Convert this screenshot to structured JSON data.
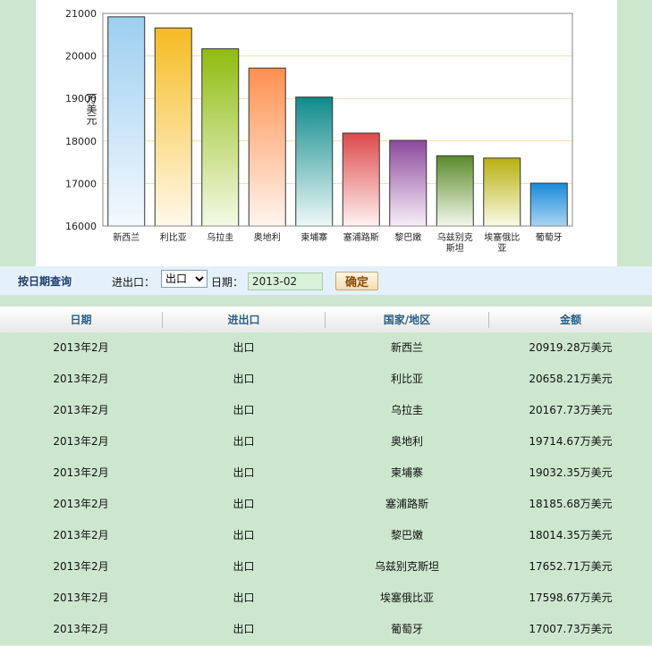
{
  "chart_data": {
    "type": "bar",
    "categories": [
      "新西兰",
      "利比亚",
      "乌拉圭",
      "奥地利",
      "柬埔寨",
      "塞浦路斯",
      "黎巴嫩",
      "乌兹别克斯坦",
      "埃塞俄比亚",
      "葡萄牙"
    ],
    "category_display": [
      [
        "新西兰"
      ],
      [
        "利比亚"
      ],
      [
        "乌拉圭"
      ],
      [
        "奥地利"
      ],
      [
        "柬埔寨"
      ],
      [
        "塞浦路斯"
      ],
      [
        "黎巴嫩"
      ],
      [
        "乌兹别克",
        "斯坦"
      ],
      [
        "埃塞俄比",
        "亚"
      ],
      [
        "葡萄牙"
      ]
    ],
    "values": [
      20919.28,
      20658.21,
      20167.73,
      19714.67,
      19032.35,
      18185.68,
      18014.35,
      17652.71,
      17598.67,
      17007.73
    ],
    "ylabel": "万美元",
    "ylim": [
      16000,
      21000
    ],
    "yticks": [
      16000,
      17000,
      18000,
      19000,
      20000,
      21000
    ],
    "grid": true,
    "colors": [
      [
        "#9ccff0",
        "#f4f9fe"
      ],
      [
        "#f5bb22",
        "#fff9ea"
      ],
      [
        "#8fbc10",
        "#f4fae6"
      ],
      [
        "#ff9050",
        "#fff5ee"
      ],
      [
        "#0f8a8a",
        "#eef8f8"
      ],
      [
        "#dd4a4a",
        "#fff1f1"
      ],
      [
        "#8c4a9c",
        "#f8eef9"
      ],
      [
        "#5a8a2a",
        "#f2f8ec"
      ],
      [
        "#b8b010",
        "#fafae6"
      ],
      [
        "#1a8ad8",
        "#a8d4f2"
      ]
    ]
  },
  "query": {
    "title": "按日期查询",
    "io_label": "进出口：",
    "io_selected": "出口",
    "date_label": "日期：",
    "date_value": "2013-02",
    "confirm_label": "确定"
  },
  "table": {
    "headers": [
      "日期",
      "进出口",
      "国家/地区",
      "金额"
    ],
    "rows": [
      [
        "2013年2月",
        "出口",
        "新西兰",
        "20919.28万美元"
      ],
      [
        "2013年2月",
        "出口",
        "利比亚",
        "20658.21万美元"
      ],
      [
        "2013年2月",
        "出口",
        "乌拉圭",
        "20167.73万美元"
      ],
      [
        "2013年2月",
        "出口",
        "奥地利",
        "19714.67万美元"
      ],
      [
        "2013年2月",
        "出口",
        "柬埔寨",
        "19032.35万美元"
      ],
      [
        "2013年2月",
        "出口",
        "塞浦路斯",
        "18185.68万美元"
      ],
      [
        "2013年2月",
        "出口",
        "黎巴嫩",
        "18014.35万美元"
      ],
      [
        "2013年2月",
        "出口",
        "乌兹别克斯坦",
        "17652.71万美元"
      ],
      [
        "2013年2月",
        "出口",
        "埃塞俄比亚",
        "17598.67万美元"
      ],
      [
        "2013年2月",
        "出口",
        "葡萄牙",
        "17007.73万美元"
      ]
    ]
  }
}
